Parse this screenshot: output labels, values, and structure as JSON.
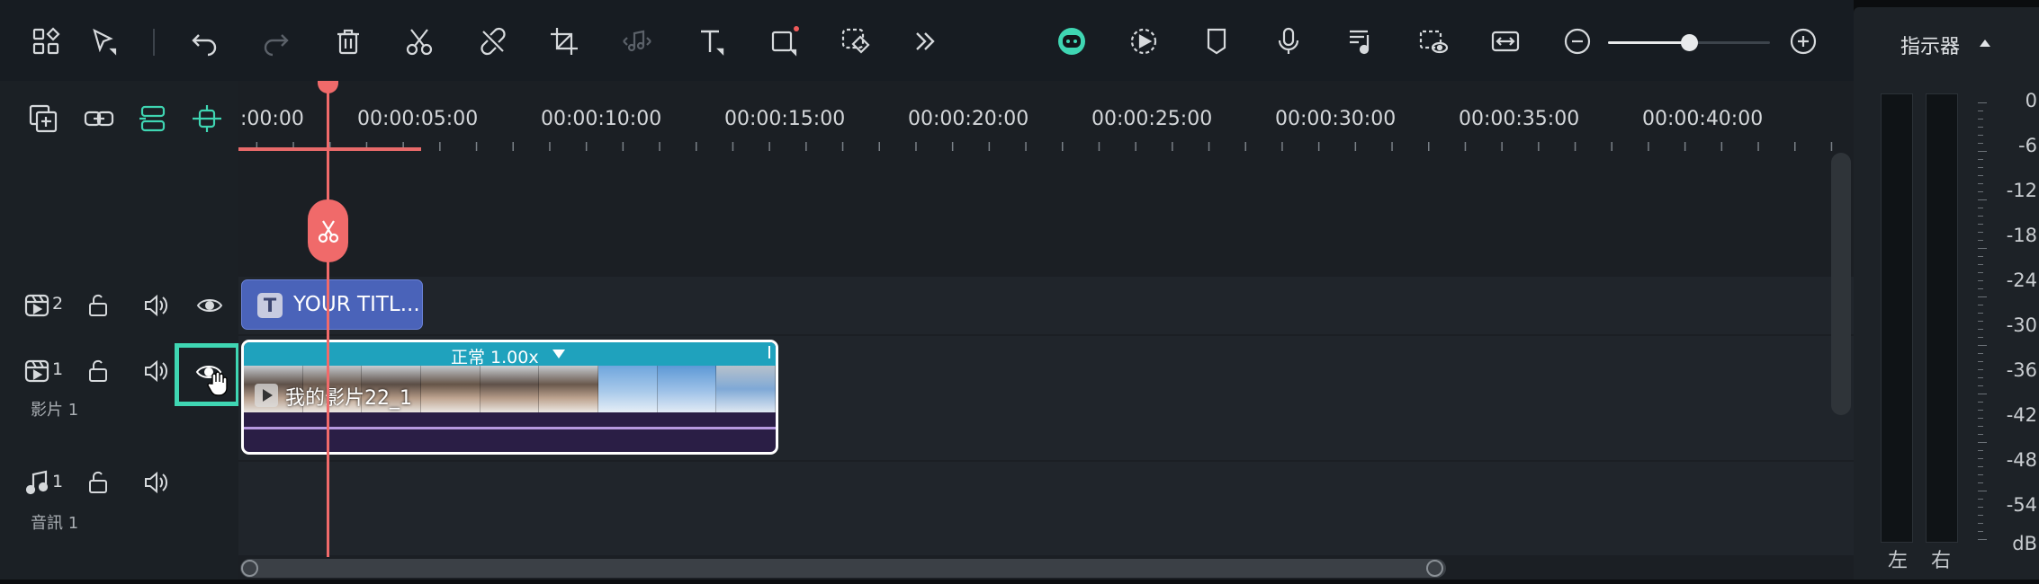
{
  "toolbar": {
    "icons": [
      {
        "name": "layout-grid-icon"
      },
      {
        "name": "select-pointer-icon"
      },
      {
        "name": "undo-icon"
      },
      {
        "name": "redo-icon"
      },
      {
        "name": "delete-icon"
      },
      {
        "name": "split-scissors-icon"
      },
      {
        "name": "unlink-icon"
      },
      {
        "name": "crop-icon"
      },
      {
        "name": "audio-edit-icon"
      },
      {
        "name": "text-icon"
      },
      {
        "name": "shape-icon"
      },
      {
        "name": "mask-icon"
      },
      {
        "name": "more-icon"
      },
      {
        "name": "ai-assistant-icon"
      },
      {
        "name": "render-preview-icon"
      },
      {
        "name": "marker-icon"
      },
      {
        "name": "microphone-icon"
      },
      {
        "name": "music-list-icon"
      },
      {
        "name": "preview-screen-icon"
      },
      {
        "name": "fit-timeline-icon"
      },
      {
        "name": "zoom-out-icon"
      },
      {
        "name": "zoom-in-icon"
      }
    ],
    "zoom_level": 0.5
  },
  "track_panel": {
    "top_icons": [
      "add-track-icon",
      "link-icon",
      "align-icon",
      "magnet-snap-icon"
    ],
    "tracks": [
      {
        "id": "video2",
        "number": "2",
        "name": ""
      },
      {
        "id": "video1",
        "number": "1",
        "name": "影片 1"
      },
      {
        "id": "audio1",
        "number": "1",
        "name": "音訊 1"
      }
    ]
  },
  "ruler": {
    "labels": [
      ":00:00",
      "00:00:05:00",
      "00:00:10:00",
      "00:00:15:00",
      "00:00:20:00",
      "00:00:25:00",
      "00:00:30:00",
      "00:00:35:00",
      "00:00:40:00"
    ]
  },
  "clips": {
    "title": {
      "text": "YOUR TITL...",
      "badge": "T"
    },
    "video": {
      "speed_label": "正常 1.00x",
      "name": "我的影片22_1"
    }
  },
  "meter": {
    "title": "指示器",
    "left_label": "左",
    "right_label": "右",
    "scale": [
      "0",
      "-6",
      "-12",
      "-18",
      "-24",
      "-30",
      "-36",
      "-42",
      "-48",
      "-54",
      "dB"
    ]
  },
  "colors": {
    "accent_green": "#3fd6b3",
    "playhead_red": "#f06a6a",
    "title_clip_blue": "#4a63b9",
    "speed_bar_teal": "#1fa2bd"
  }
}
